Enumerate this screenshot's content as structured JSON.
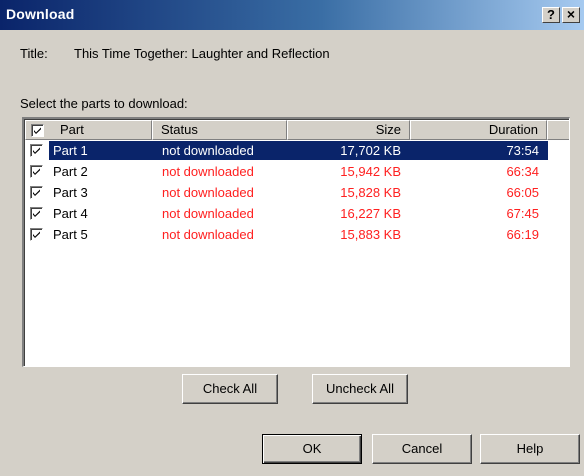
{
  "window": {
    "title": "Download",
    "help_glyph": "?",
    "close_glyph": "×"
  },
  "info": {
    "title_label": "Title:",
    "title_value": "This Time Together: Laughter and Reflection",
    "select_label": "Select the parts to download:"
  },
  "list": {
    "columns": {
      "part": "Part",
      "status": "Status",
      "size": "Size",
      "duration": "Duration"
    },
    "header_checked": true,
    "selected_row": 0,
    "rows": [
      {
        "part": "Part 1",
        "status": "not downloaded",
        "size": "17,702 KB",
        "duration": "73:54",
        "checked": true
      },
      {
        "part": "Part 2",
        "status": "not downloaded",
        "size": "15,942 KB",
        "duration": "66:34",
        "checked": true
      },
      {
        "part": "Part 3",
        "status": "not downloaded",
        "size": "15,828 KB",
        "duration": "66:05",
        "checked": true
      },
      {
        "part": "Part 4",
        "status": "not downloaded",
        "size": "16,227 KB",
        "duration": "67:45",
        "checked": true
      },
      {
        "part": "Part 5",
        "status": "not downloaded",
        "size": "15,883 KB",
        "duration": "66:19",
        "checked": true
      }
    ]
  },
  "buttons": {
    "check_all": "Check All",
    "uncheck_all": "Uncheck All",
    "ok": "OK",
    "cancel": "Cancel",
    "help": "Help"
  },
  "colors": {
    "title_bar_start": "#0a246a",
    "title_bar_end": "#a6caf0",
    "status_text": "#ff2020",
    "selection": "#0a246a",
    "face": "#d4d0c8"
  },
  "icons": {
    "checkbox_mark": "checkmark-icon"
  }
}
